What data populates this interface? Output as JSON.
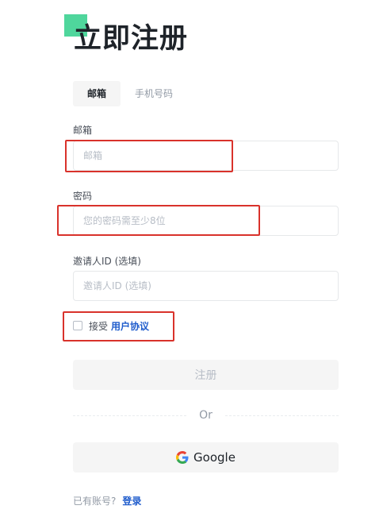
{
  "header": {
    "title": "立即注册"
  },
  "tabs": [
    {
      "label": "邮箱",
      "active": true
    },
    {
      "label": "手机号码",
      "active": false
    }
  ],
  "form": {
    "email": {
      "label": "邮箱",
      "value": "",
      "placeholder": "邮箱"
    },
    "password": {
      "label": "密码",
      "value": "",
      "placeholder": "您的密码需至少8位"
    },
    "referral": {
      "label": "邀请人ID (选填)",
      "value": "",
      "placeholder": "邀请人ID (选填)"
    },
    "agreement": {
      "checked": false,
      "prefix": "接受",
      "link_label": "用户协议"
    }
  },
  "actions": {
    "register_label": "注册",
    "or_label": "Or",
    "google_label": "Google"
  },
  "footer": {
    "login_prompt": "已有账号?",
    "login_link": "登录"
  },
  "colors": {
    "accent": "#4fd69c",
    "link": "#1f5ccc",
    "highlight": "#d9322b"
  },
  "icons": {
    "google": "google-icon"
  }
}
